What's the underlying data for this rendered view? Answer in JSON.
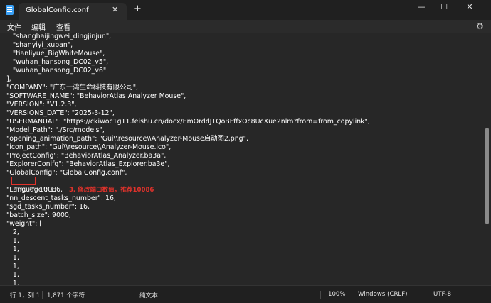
{
  "window": {
    "tab_title": "GlobalConfig.conf",
    "tab_close": "✕",
    "new_tab": "+",
    "minimize": "—",
    "maximize": "☐",
    "close": "✕"
  },
  "menu": {
    "file": "文件",
    "edit": "编辑",
    "view": "查看",
    "settings_icon": "gear-icon"
  },
  "editor": {
    "lines": [
      "      \"shanghaijingwei_dingjinjun\",",
      "      \"shanyiyi_xupan\",",
      "      \"tianliyue_BigWhiteMouse\",",
      "      \"wuhan_hansong_DC02_v5\",",
      "      \"wuhan_hansong_DC02_v6\"",
      "   ],",
      "   \"COMPANY\": \"广东一湾生命科技有限公司\",",
      "   \"SOFTWARE_NAME\": \"BehaviorAtlas Analyzer Mouse\",",
      "   \"VERSION\": \"V1.2.3\",",
      "   \"VERSIONS_DATE\": \"2025-3-12\",",
      "   \"USERMANUAL\": \"https://ckiwoc1g11.feishu.cn/docx/EmOrddJTQoBFffxOc8UcXue2nlm?from=from_copylink\",",
      "   \"Model_Path\": \"./Src/models\",",
      "   \"opening_animation_path\": \"Gui\\\\resource\\\\Analyzer-Mouse启动图2.png\",",
      "   \"icon_path\": \"Gui\\\\resource\\\\Analyzer-Mouse.ico\",",
      "   \"ProjectConfig\": \"BehaviorAtlas_Analyzer.ba3a\",",
      "   \"ExplorerConifg\": \"BehaviorAtlas_Explorer.ba3e\",",
      "   \"GlobalConfig\": \"GlobalConfig.conf\",",
      "   \"POR\": 10086,",
      "   \"Language\": 1,",
      "   \"nn_descent_tasks_number\": 16,",
      "   \"sgd_tasks_number\": 16,",
      "   \"batch_size\": 9000,",
      "   \"weight\": [",
      "      2,",
      "      1,",
      "      1,",
      "      1,",
      "      1,",
      "      1,",
      "      1,"
    ],
    "annotation": "3. 修改端口数值，推荐10086"
  },
  "status": {
    "position": "行 1，列 1",
    "char_count": "1,871 个字符",
    "format": "纯文本",
    "zoom": "100%",
    "line_ending": "Windows (CRLF)",
    "encoding": "UTF-8"
  },
  "colors": {
    "background": "#272727",
    "highlight": "#e1322b"
  }
}
